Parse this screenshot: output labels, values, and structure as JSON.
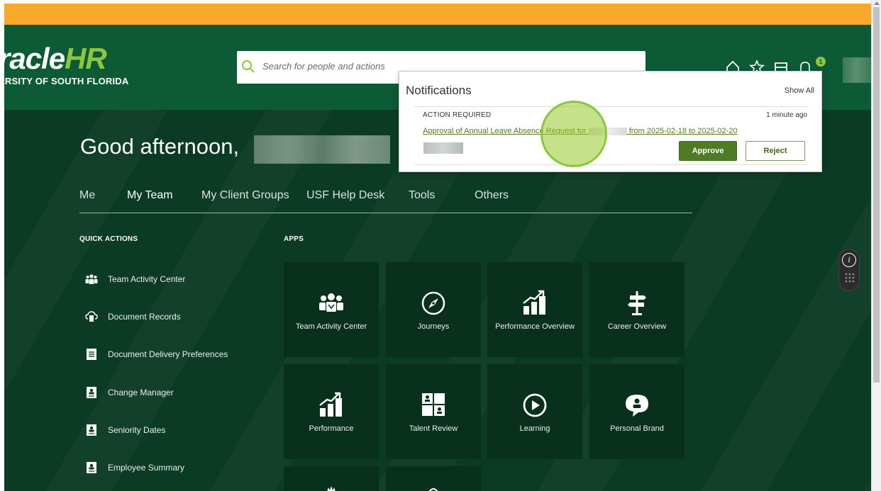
{
  "header": {
    "logo_main": "OracleHR",
    "logo_main_left": "racle",
    "logo_main_right": "HR",
    "logo_sub": "ERSITY OF SOUTH FLORIDA",
    "search_placeholder": "Search for people and actions",
    "notification_count": "1",
    "icons": [
      "home-icon",
      "favorites-star-icon",
      "watchlist-flag-icon",
      "notifications-bell-icon"
    ]
  },
  "greeting": {
    "text": "Good afternoon,"
  },
  "tabs": [
    {
      "label": "Me",
      "active": false
    },
    {
      "label": "My Team",
      "active": true
    },
    {
      "label": "My Client Groups",
      "active": false
    },
    {
      "label": "USF Help Desk",
      "active": false
    },
    {
      "label": "Tools",
      "active": false
    },
    {
      "label": "Others",
      "active": false
    }
  ],
  "quick_actions": {
    "title": "QUICK ACTIONS",
    "items": [
      {
        "label": "Team Activity Center",
        "icon": "team-icon"
      },
      {
        "label": "Document Records",
        "icon": "document-cloud-icon"
      },
      {
        "label": "Document Delivery Preferences",
        "icon": "document-list-icon"
      },
      {
        "label": "Change Manager",
        "icon": "person-card-icon"
      },
      {
        "label": "Seniority Dates",
        "icon": "person-card-icon"
      },
      {
        "label": "Employee Summary",
        "icon": "person-card-icon"
      }
    ]
  },
  "apps": {
    "title": "APPS",
    "tiles": [
      {
        "label": "Team Activity Center",
        "icon": "team-icon"
      },
      {
        "label": "Journeys",
        "icon": "compass-icon"
      },
      {
        "label": "Performance Overview",
        "icon": "performance-chart-icon"
      },
      {
        "label": "Career Overview",
        "icon": "signpost-icon"
      },
      {
        "label": "Performance",
        "icon": "performance-chart-icon"
      },
      {
        "label": "Talent Review",
        "icon": "talent-grid-icon"
      },
      {
        "label": "Learning",
        "icon": "play-circle-icon"
      },
      {
        "label": "Personal Brand",
        "icon": "speech-person-icon"
      }
    ]
  },
  "notifications": {
    "title": "Notifications",
    "show_all": "Show All",
    "item": {
      "category": "ACTION REQUIRED",
      "time": "1 minute ago",
      "link_prefix": "Approval of Annual Leave Absence Request for",
      "link_suffix": "from 2025-02-18 to 2025-02-20",
      "approve_label": "Approve",
      "reject_label": "Reject"
    }
  },
  "colors": {
    "brand_green": "#0d5a36",
    "accent_lime": "#8cc63f",
    "banner_orange": "#f8a82c",
    "approve_green": "#4f7a26"
  }
}
